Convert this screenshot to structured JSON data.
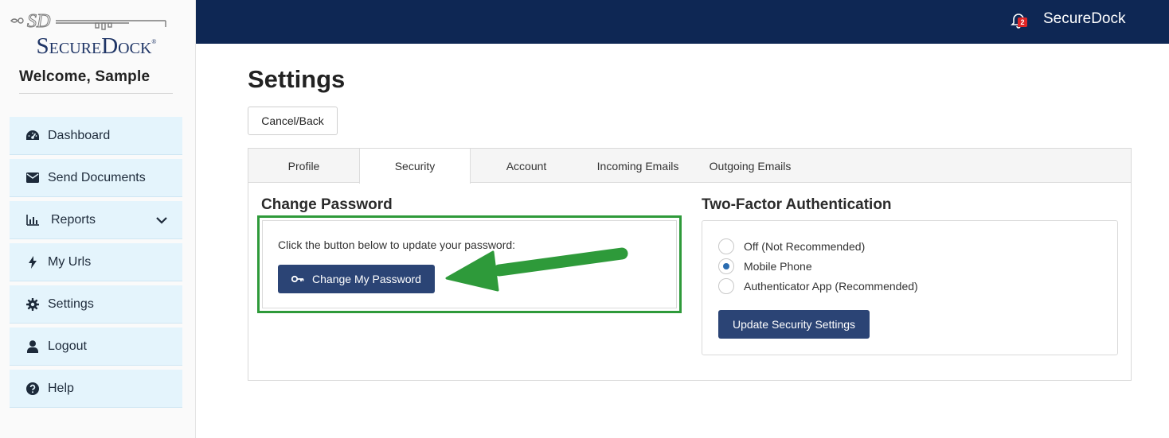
{
  "sidebar": {
    "logo": {
      "monogram": "SD",
      "wordmark": "SecureDock",
      "trademark": "®"
    },
    "welcome": "Welcome, Sample",
    "items": [
      {
        "label": "Dashboard",
        "icon": "dashboard-icon"
      },
      {
        "label": "Send Documents",
        "icon": "envelope-icon"
      },
      {
        "label": "Reports",
        "icon": "bar-chart-icon",
        "has_submenu": true
      },
      {
        "label": "My Urls",
        "icon": "bolt-icon"
      },
      {
        "label": "Settings",
        "icon": "gear-icon"
      },
      {
        "label": "Logout",
        "icon": "user-icon"
      },
      {
        "label": "Help",
        "icon": "question-circle-icon"
      }
    ]
  },
  "topbar": {
    "notification_count": "2",
    "brand": "SecureDock"
  },
  "page": {
    "title": "Settings",
    "back_button": "Cancel/Back"
  },
  "tabs": [
    {
      "label": "Profile",
      "active": false
    },
    {
      "label": "Security",
      "active": true
    },
    {
      "label": "Account",
      "active": false
    },
    {
      "label": "Incoming Emails",
      "active": false
    },
    {
      "label": "Outgoing Emails",
      "active": false
    }
  ],
  "change_password": {
    "title": "Change Password",
    "description": "Click the button below to update your password:",
    "button": "Change My Password",
    "button_icon": "key-icon"
  },
  "two_factor": {
    "title": "Two-Factor Authentication",
    "options": [
      {
        "label": "Off (Not Recommended)",
        "checked": false
      },
      {
        "label": "Mobile Phone",
        "checked": true
      },
      {
        "label": "Authenticator App (Recommended)",
        "checked": false
      }
    ],
    "button": "Update Security Settings"
  },
  "colors": {
    "topbar": "#0e2754",
    "primary_button": "#2b4475",
    "nav_item_bg": "#e4f4fc",
    "highlight_green": "#2e9a3a",
    "badge_red": "#e02727"
  }
}
